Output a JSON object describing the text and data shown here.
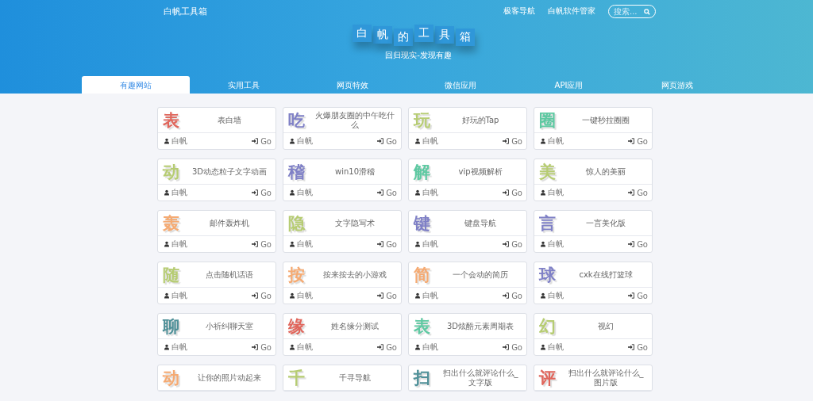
{
  "header": {
    "brand": "白帆工具箱",
    "nav": [
      "极客导航",
      "白帆软件管家"
    ],
    "search": {
      "placeholder": "搜索..."
    },
    "title_tiles": [
      "白",
      "帆",
      "的",
      "工",
      "具",
      "箱"
    ],
    "subtitle": "回归现实-发现有趣"
  },
  "tabs": [
    {
      "label": "有趣网站",
      "selected": true
    },
    {
      "label": "实用工具",
      "selected": false
    },
    {
      "label": "网页特效",
      "selected": false
    },
    {
      "label": "微信应用",
      "selected": false
    },
    {
      "label": "API应用",
      "selected": false
    },
    {
      "label": "网页游戏",
      "selected": false
    }
  ],
  "cards": [
    {
      "char": "表",
      "color": "#e0665c",
      "desc": "表白墙",
      "author": "白帆",
      "go": "Go"
    },
    {
      "char": "吃",
      "color": "#7f80c6",
      "desc": "火爆朋友圈的中午吃什么",
      "author": "白帆",
      "go": "Go"
    },
    {
      "char": "玩",
      "color": "#b6cc72",
      "desc": "好玩的Tap",
      "author": "白帆",
      "go": "Go"
    },
    {
      "char": "圈",
      "color": "#5ec9a2",
      "desc": "一键秒拉圈圈",
      "author": "白帆",
      "go": "Go"
    },
    {
      "char": "动",
      "color": "#b6cc72",
      "desc": "3D动态粒子文字动画",
      "author": "白帆",
      "go": "Go"
    },
    {
      "char": "稽",
      "color": "#7f80c6",
      "desc": "win10滑稽",
      "author": "白帆",
      "go": "Go"
    },
    {
      "char": "解",
      "color": "#5ec9a2",
      "desc": "vip视频解析",
      "author": "白帆",
      "go": "Go"
    },
    {
      "char": "美",
      "color": "#b6cc72",
      "desc": "惊人的美丽",
      "author": "白帆",
      "go": "Go"
    },
    {
      "char": "轰",
      "color": "#f5aa72",
      "desc": "邮件轰炸机",
      "author": "白帆",
      "go": "Go"
    },
    {
      "char": "隐",
      "color": "#b6cc72",
      "desc": "文字隐写术",
      "author": "白帆",
      "go": "Go"
    },
    {
      "char": "键",
      "color": "#7f80c6",
      "desc": "键盘导航",
      "author": "白帆",
      "go": "Go"
    },
    {
      "char": "言",
      "color": "#7f80c6",
      "desc": "一言美化版",
      "author": "白帆",
      "go": "Go"
    },
    {
      "char": "随",
      "color": "#b6cc72",
      "desc": "点击随机话语",
      "author": "白帆",
      "go": "Go"
    },
    {
      "char": "按",
      "color": "#f5aa72",
      "desc": "按来按去的小游戏",
      "author": "白帆",
      "go": "Go"
    },
    {
      "char": "简",
      "color": "#f5aa72",
      "desc": "一个会动的简历",
      "author": "白帆",
      "go": "Go"
    },
    {
      "char": "球",
      "color": "#7f80c6",
      "desc": "cxk在线打篮球",
      "author": "白帆",
      "go": "Go"
    },
    {
      "char": "聊",
      "color": "#4f9098",
      "desc": "小祈纠聊天室",
      "author": "白帆",
      "go": "Go"
    },
    {
      "char": "缘",
      "color": "#e0665c",
      "desc": "姓名缘分测试",
      "author": "白帆",
      "go": "Go"
    },
    {
      "char": "表",
      "color": "#5ec9a2",
      "desc": "3D炫酷元素周期表",
      "author": "白帆",
      "go": "Go"
    },
    {
      "char": "幻",
      "color": "#b6cc72",
      "desc": "视幻",
      "author": "白帆",
      "go": "Go"
    },
    {
      "char": "动",
      "color": "#f5aa72",
      "desc": "让你的照片动起来"
    },
    {
      "char": "千",
      "color": "#b6cc72",
      "desc": "千寻导航"
    },
    {
      "char": "扫",
      "color": "#4f9098",
      "desc": "扫出什么就评论什么_文字版"
    },
    {
      "char": "评",
      "color": "#e0665c",
      "desc": "扫出什么就评论什么_图片版"
    }
  ]
}
